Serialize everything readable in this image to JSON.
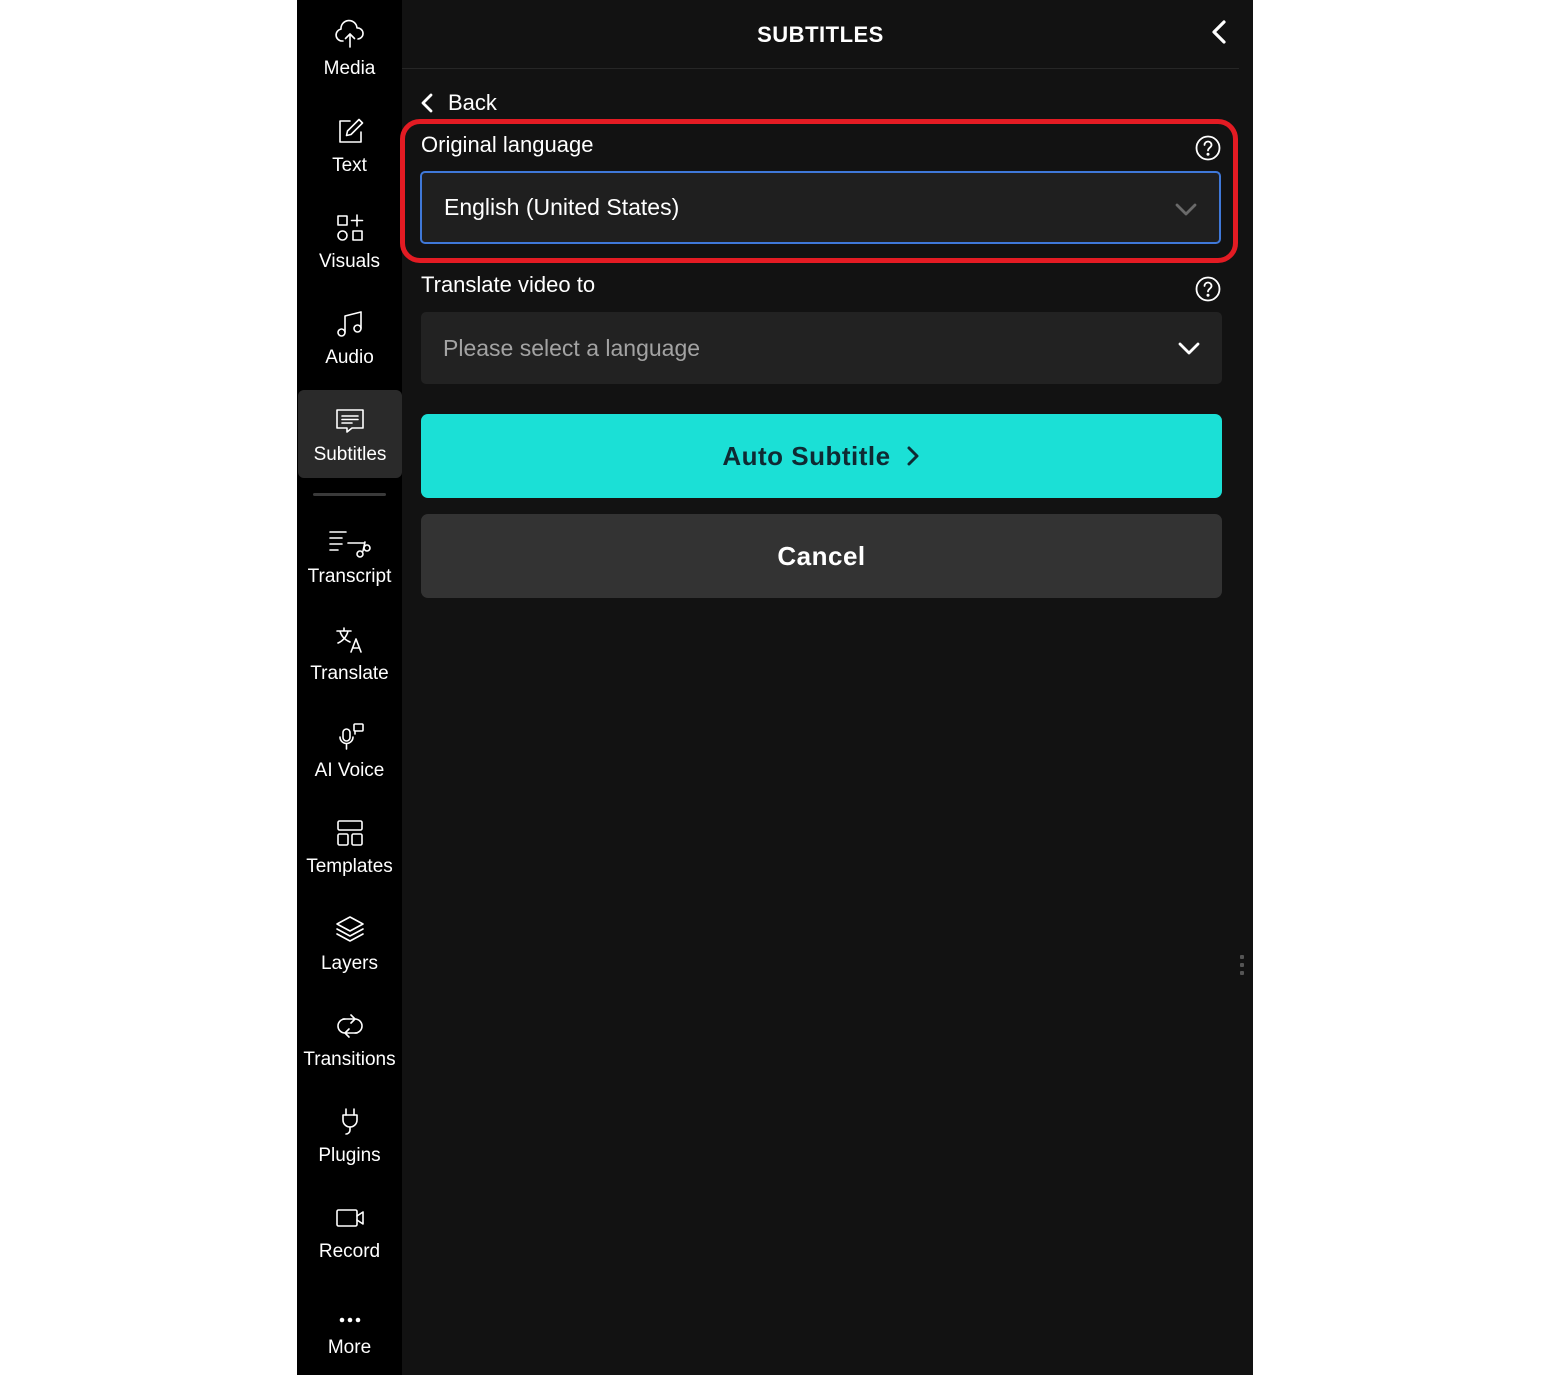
{
  "colors": {
    "accent": "#1be0d6",
    "highlight": "#e31b23",
    "focus_border": "#3f78d8",
    "panel_bg": "#121212",
    "sidebar_bg": "#000000"
  },
  "sidebar": {
    "items": [
      {
        "label": "Media",
        "icon": "cloud-upload-icon"
      },
      {
        "label": "Text",
        "icon": "edit-icon"
      },
      {
        "label": "Visuals",
        "icon": "shapes-icon"
      },
      {
        "label": "Audio",
        "icon": "music-note-icon"
      },
      {
        "label": "Subtitles",
        "icon": "subtitles-icon",
        "active": true
      },
      {
        "label": "Transcript",
        "icon": "transcript-icon"
      },
      {
        "label": "Translate",
        "icon": "translate-icon"
      },
      {
        "label": "AI Voice",
        "icon": "microphone-icon"
      },
      {
        "label": "Templates",
        "icon": "templates-icon"
      },
      {
        "label": "Layers",
        "icon": "layers-icon"
      },
      {
        "label": "Transitions",
        "icon": "transitions-icon"
      },
      {
        "label": "Plugins",
        "icon": "plug-icon"
      },
      {
        "label": "Record",
        "icon": "video-camera-icon"
      },
      {
        "label": "More",
        "icon": "more-icon"
      }
    ]
  },
  "panel": {
    "title": "SUBTITLES",
    "back_label": "Back",
    "original_language": {
      "label": "Original language",
      "value": "English (United States)"
    },
    "translate_to": {
      "label": "Translate video to",
      "placeholder": "Please select a language"
    },
    "auto_subtitle_label": "Auto Subtitle",
    "cancel_label": "Cancel"
  }
}
